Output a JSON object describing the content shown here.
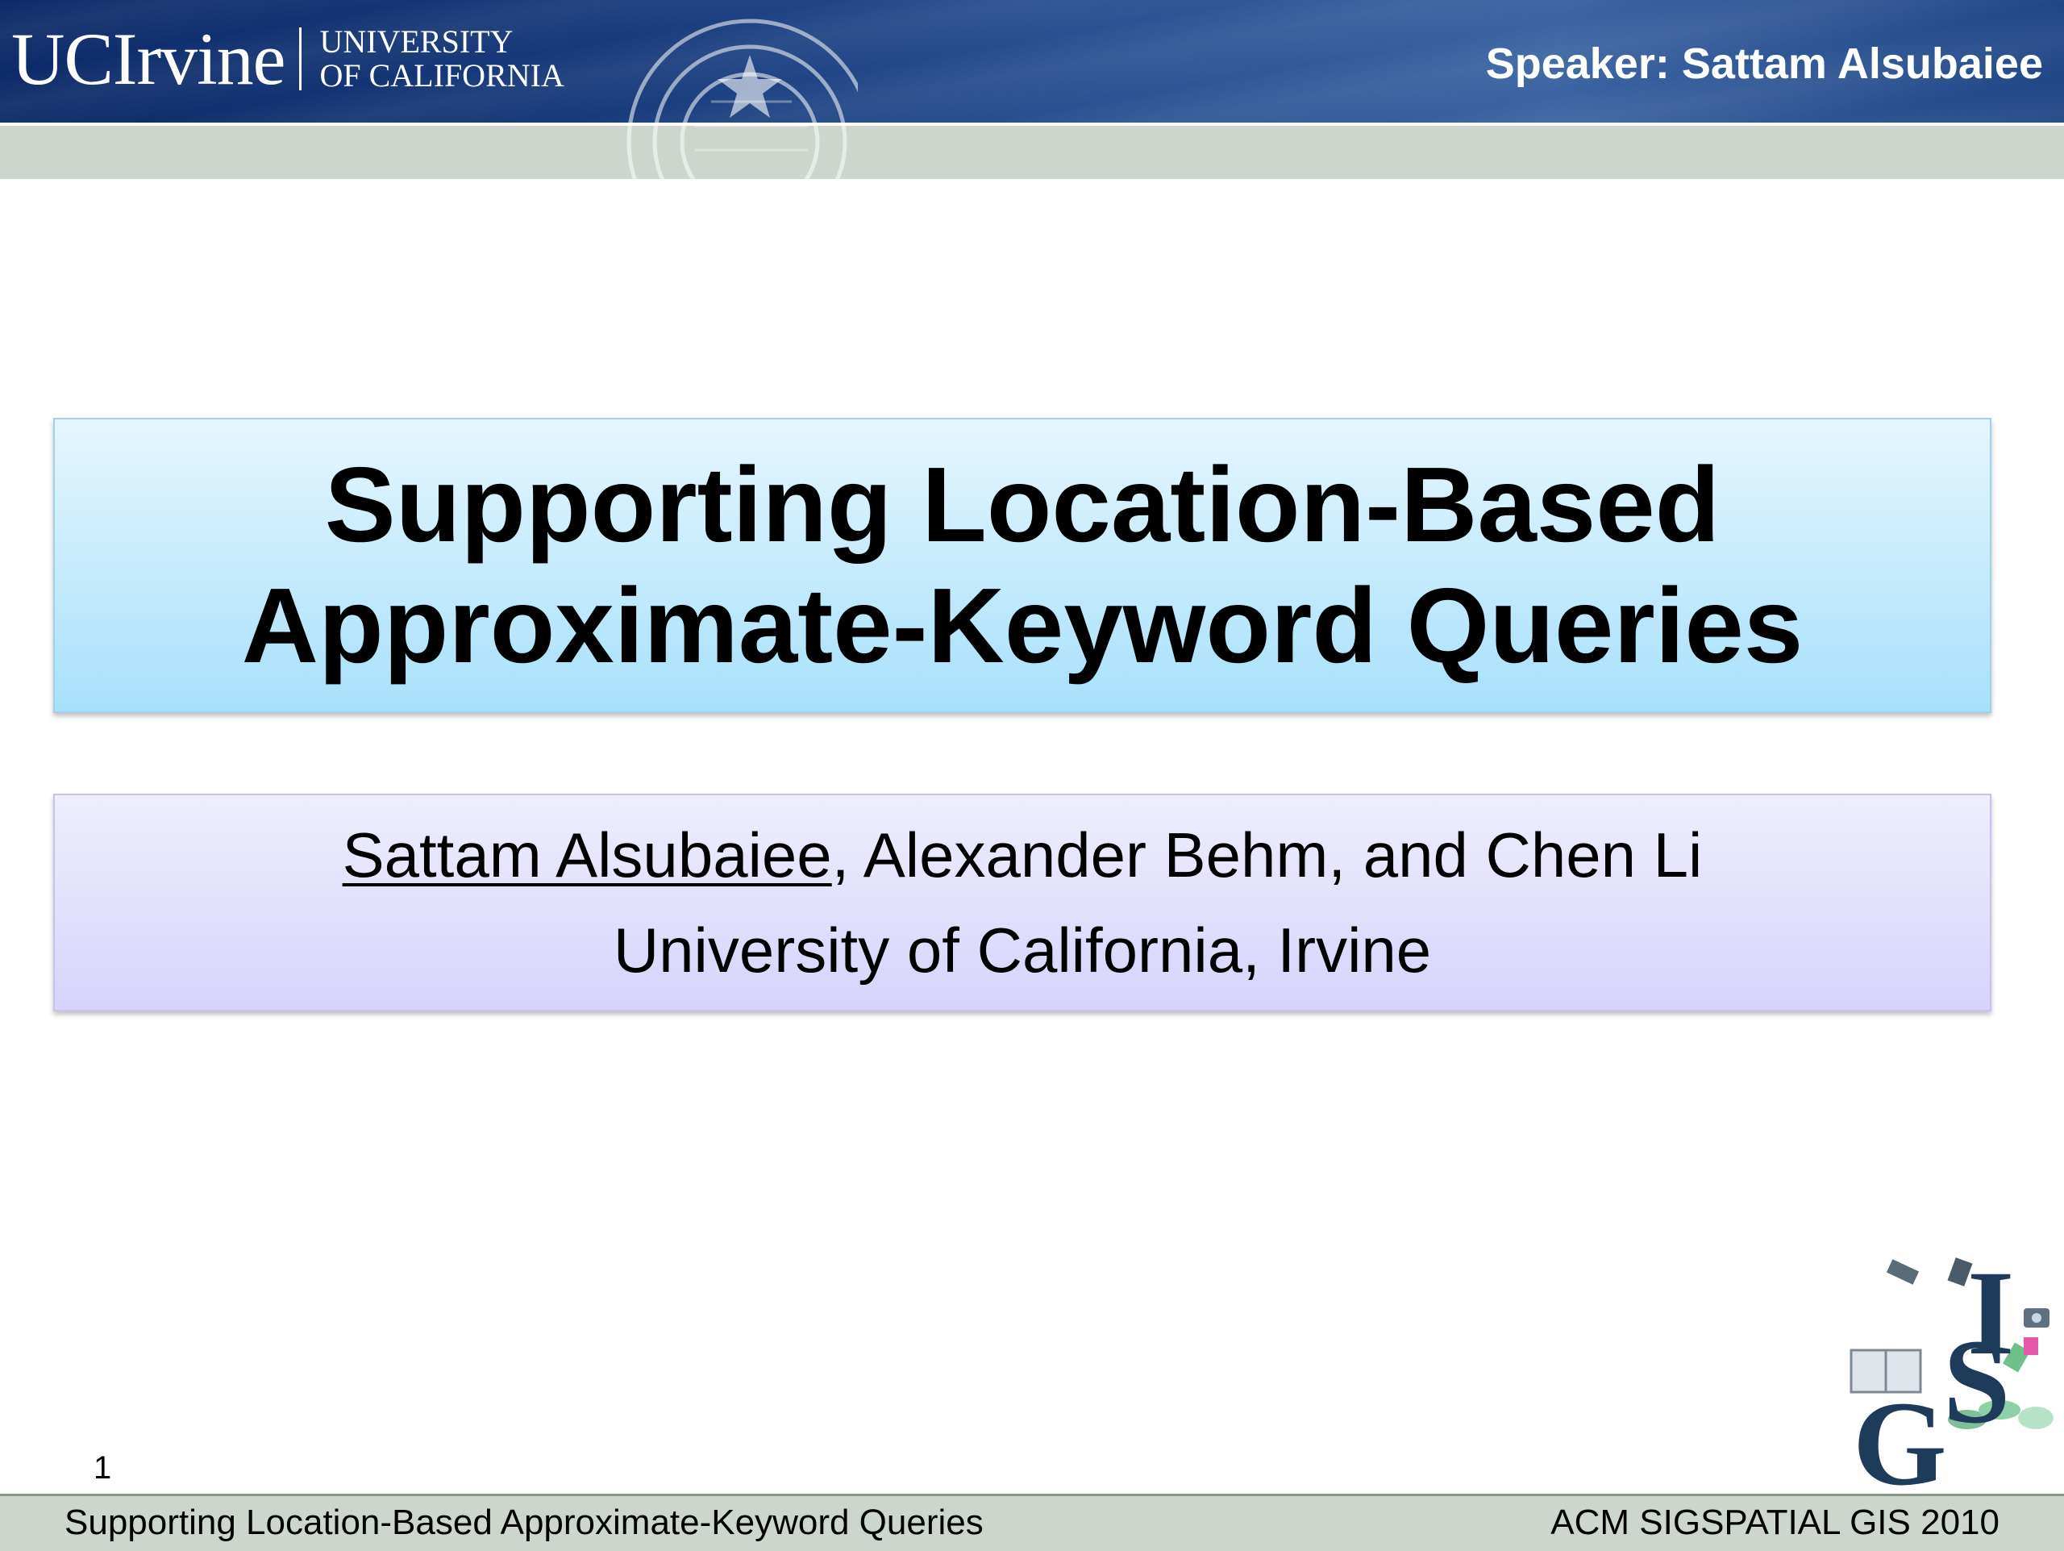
{
  "header": {
    "logo_word": "UCIrvine",
    "logo_univ_line1": "UNIVERSITY",
    "logo_univ_line2": "OF CALIFORNIA",
    "speaker": "Speaker: Sattam Alsubaiee"
  },
  "title": {
    "line1": "Supporting Location-Based",
    "line2": "Approximate-Keyword Queries"
  },
  "authors": {
    "presenter": "Sattam Alsubaiee",
    "others": ", Alexander Behm, and Chen Li",
    "affiliation": "University of California, Irvine"
  },
  "slide_number": "1",
  "footer": {
    "left": "Supporting Location-Based Approximate-Keyword Queries",
    "right": "ACM SIGSPATIAL GIS 2010"
  },
  "colors": {
    "banner": "#17397a",
    "footer_bar": "#cdd6cc",
    "title_box_top": "#e6f6fe",
    "title_box_bottom": "#a8e0fb",
    "author_box_top": "#eeeefd",
    "author_box_bottom": "#d6d4fb"
  },
  "icons": [
    "uc-seal-icon",
    "gis-conference-logo-icon"
  ]
}
